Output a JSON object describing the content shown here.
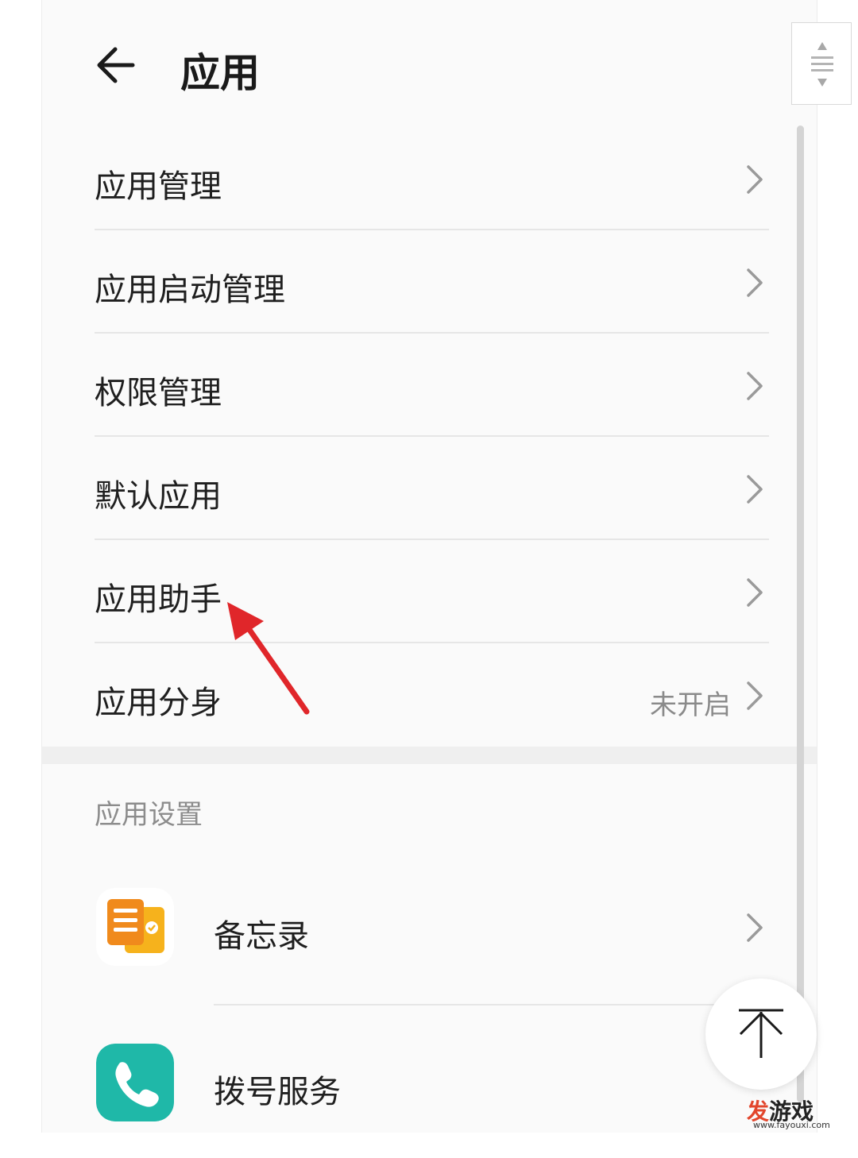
{
  "header": {
    "title": "应用"
  },
  "menu": [
    {
      "label": "应用管理",
      "value": ""
    },
    {
      "label": "应用启动管理",
      "value": ""
    },
    {
      "label": "权限管理",
      "value": ""
    },
    {
      "label": "默认应用",
      "value": ""
    },
    {
      "label": "应用助手",
      "value": ""
    },
    {
      "label": "应用分身",
      "value": "未开启"
    }
  ],
  "app_settings": {
    "title": "应用设置",
    "apps": [
      {
        "label": "备忘录",
        "icon": "memo-app-icon",
        "color": "#f5a21b"
      },
      {
        "label": "拨号服务",
        "icon": "phone-app-icon",
        "color": "#1fb8a8"
      }
    ]
  },
  "colors": {
    "annotation": "#e0262a",
    "accent_orange": "#f08a1c"
  },
  "watermark": {
    "main_first": "发",
    "main_rest": "游戏",
    "url": "www.fayouxi.com"
  }
}
